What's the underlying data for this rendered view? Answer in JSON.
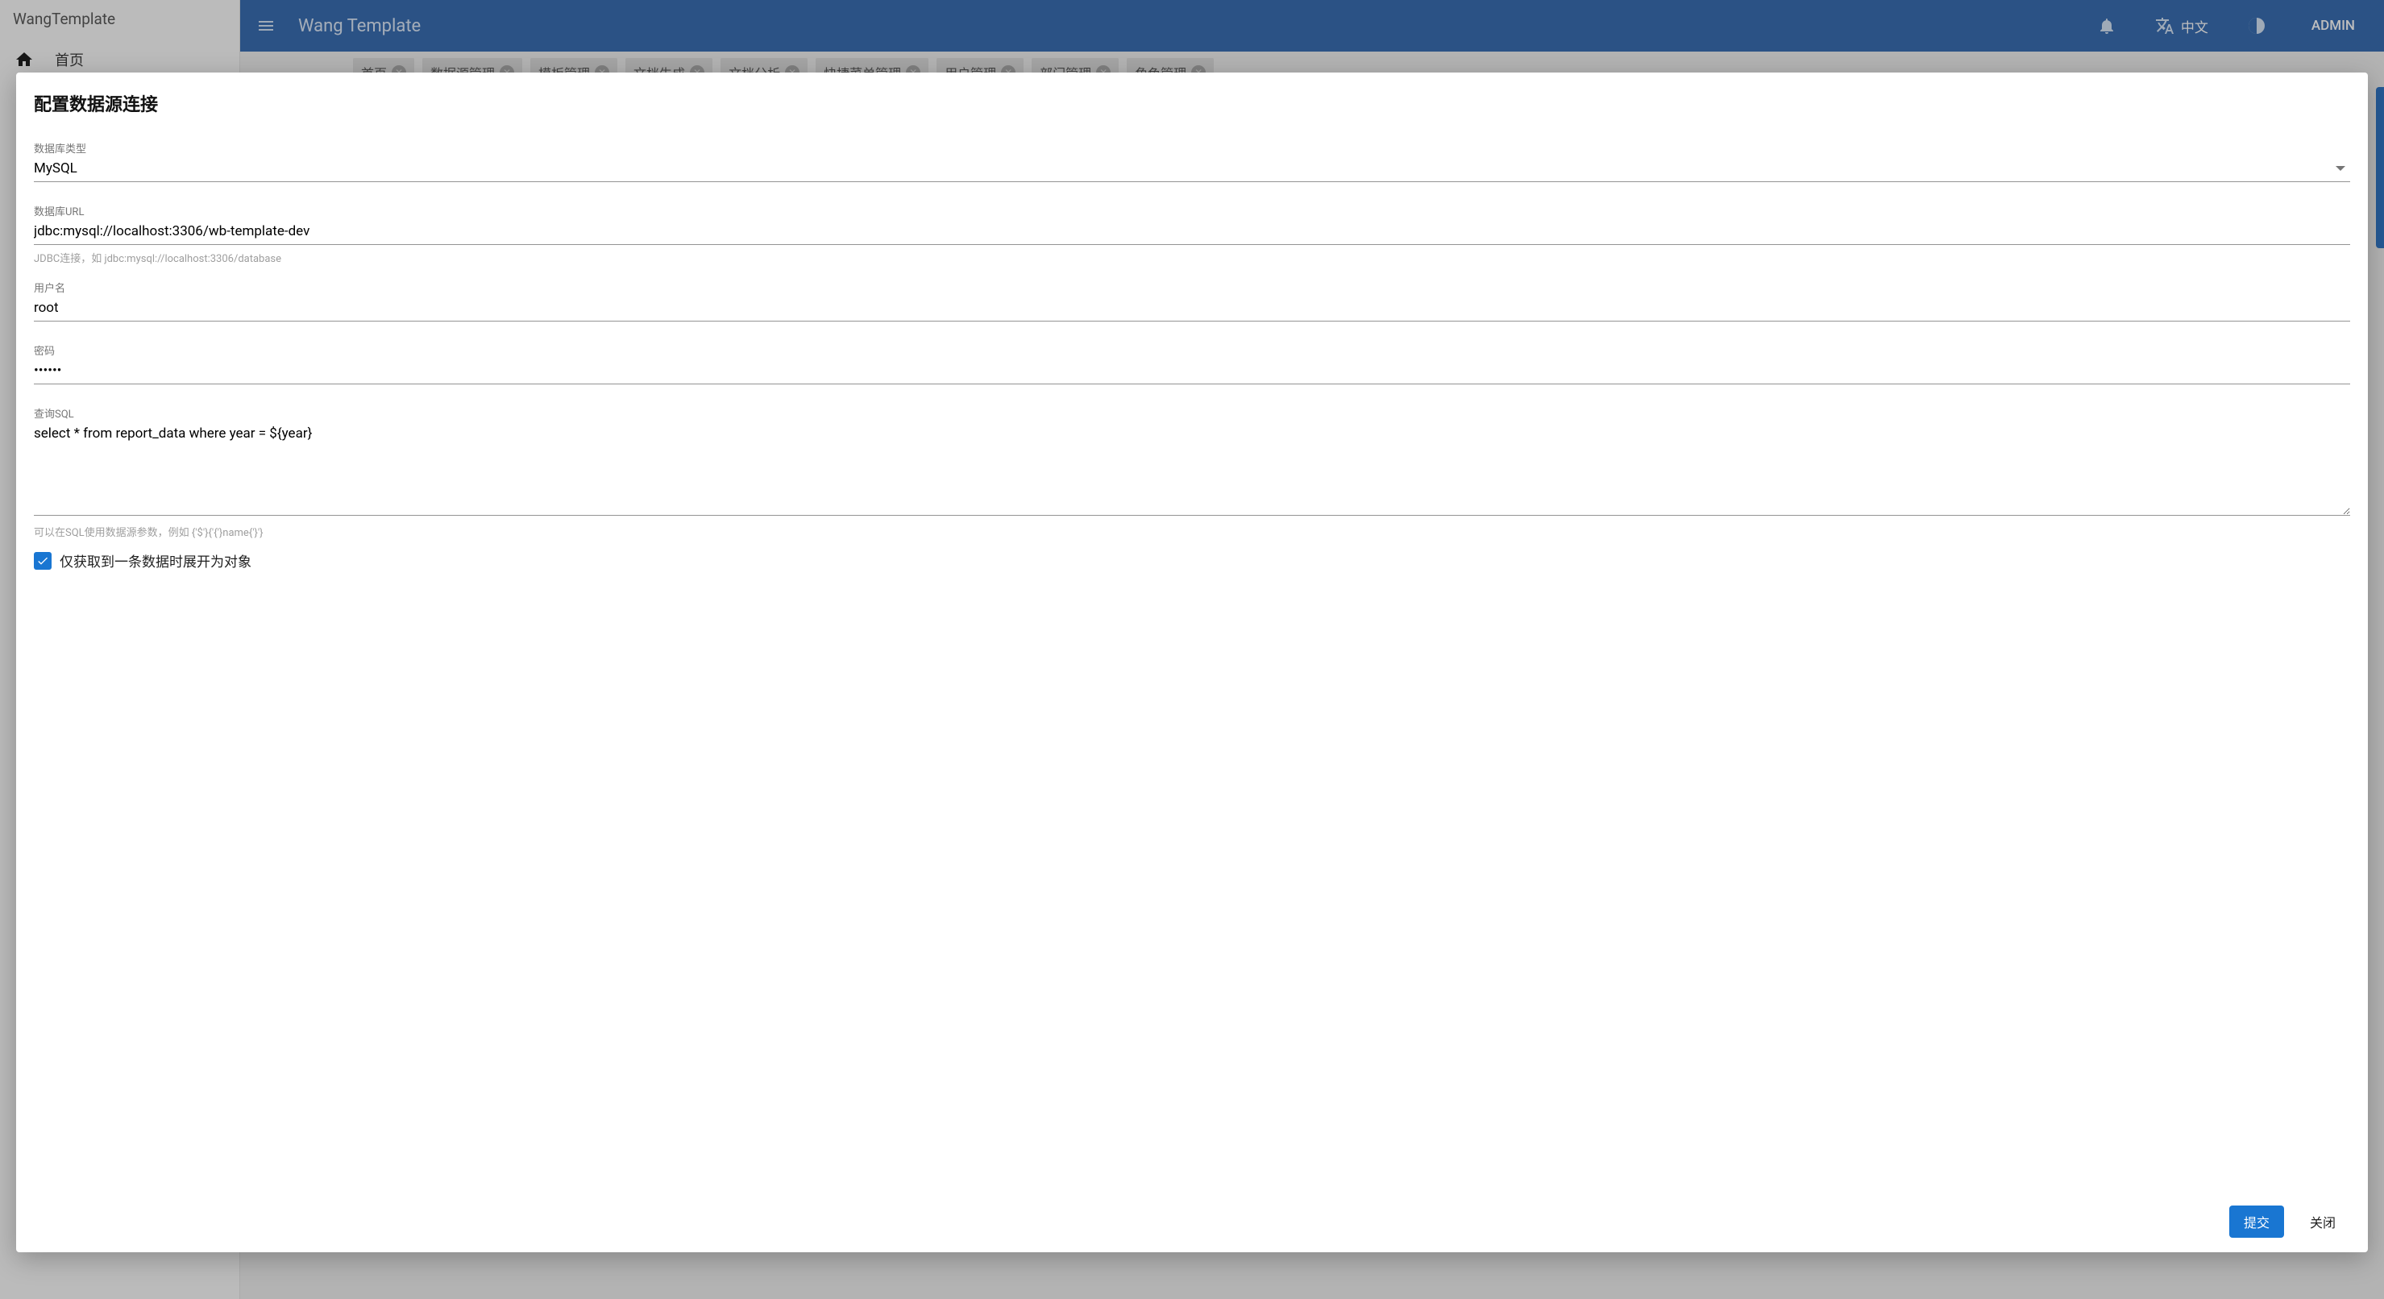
{
  "sidebar": {
    "brand": "WangTemplate",
    "items": [
      {
        "icon": "home",
        "label": "首页"
      }
    ]
  },
  "appbar": {
    "title": "Wang Template",
    "language": "中文",
    "user": "ADMIN"
  },
  "tabs": [
    {
      "label": "首页"
    },
    {
      "label": "数据源管理"
    },
    {
      "label": "模板管理"
    },
    {
      "label": "文档生成"
    },
    {
      "label": "文档分析"
    },
    {
      "label": "快捷菜单管理"
    },
    {
      "label": "用户管理"
    },
    {
      "label": "部门管理"
    },
    {
      "label": "角色管理"
    }
  ],
  "dialog": {
    "title": "配置数据源连接",
    "dbType": {
      "label": "数据库类型",
      "value": "MySQL"
    },
    "dbUrl": {
      "label": "数据库URL",
      "value": "jdbc:mysql://localhost:3306/wb-template-dev",
      "helper": "JDBC连接，如 jdbc:mysql://localhost:3306/database"
    },
    "username": {
      "label": "用户名",
      "value": "root"
    },
    "password": {
      "label": "密码",
      "value": "••••••"
    },
    "sql": {
      "label": "查询SQL",
      "value": "select * from report_data where year = ${year}",
      "helper": "可以在SQL使用数据源参数，例如 {'$'}{'{'}name{'}'}"
    },
    "checkbox": {
      "checked": true,
      "label": "仅获取到一条数据时展开为对象"
    },
    "actions": {
      "submit": "提交",
      "close": "关闭"
    }
  }
}
